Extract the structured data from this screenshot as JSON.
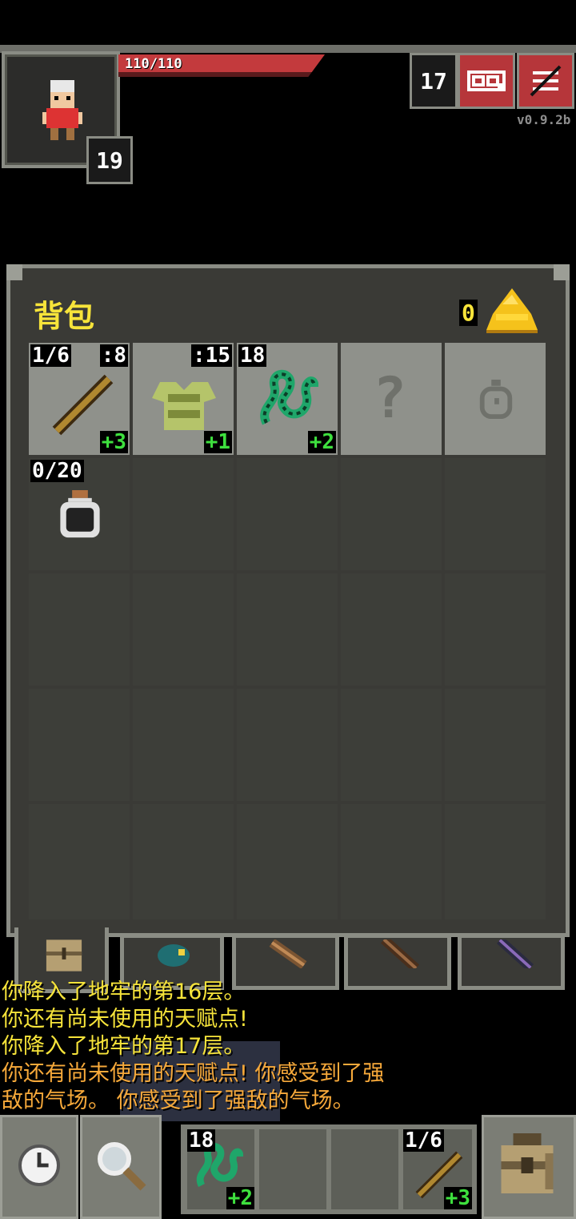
{
  "hud": {
    "hp_text": "110/110",
    "hero_level": "19",
    "depth": "17",
    "version": "v0.9.2b",
    "journal_icon": "journal-icon",
    "menu_icon": "menu-icon",
    "colors": {
      "hp": "#c33a3d",
      "accent_gold": "#f7e43a"
    }
  },
  "backpack": {
    "title": "背包",
    "gold": "0",
    "gold_icon": "gold-pile-icon",
    "equipped": [
      {
        "name": "wand",
        "icon": "wand-icon",
        "top_left": "1/6",
        "top_right": ":8",
        "level": "+3"
      },
      {
        "name": "armor",
        "icon": "armor-icon",
        "top_left": "",
        "top_right": ":15",
        "level": "+1"
      },
      {
        "name": "ring",
        "icon": "chain-ring-icon",
        "top_left": "18",
        "top_right": "",
        "level": "+2"
      },
      {
        "name": "misc-slot",
        "icon": "unknown-slot-icon",
        "top_left": "",
        "top_right": "",
        "level": ""
      },
      {
        "name": "artifact-slot",
        "icon": "bag-slot-icon",
        "top_left": "",
        "top_right": "",
        "level": ""
      }
    ],
    "items": [
      {
        "name": "dew-vial",
        "icon": "vial-icon",
        "top_left": "0/20"
      }
    ],
    "tabs": [
      {
        "name": "backpack-tab",
        "icon": "backpack-icon",
        "active": true
      },
      {
        "name": "seed-pouch-tab",
        "icon": "pouch-icon",
        "active": false
      },
      {
        "name": "scroll-holder-tab",
        "icon": "scroll-holder-icon",
        "active": false
      },
      {
        "name": "potion-bandolier-tab",
        "icon": "bandolier-icon",
        "active": false
      },
      {
        "name": "wand-holster-tab",
        "icon": "holster-icon",
        "active": false
      }
    ]
  },
  "log": {
    "lines": [
      {
        "text": "你降入了地牢的第16层。",
        "color": "#f7e43a"
      },
      {
        "text": "你还有尚未使用的天赋点!",
        "color": "#f7e43a"
      },
      {
        "text": "你降入了地牢的第17层。",
        "color": "#f7e43a"
      },
      {
        "text": "你还有尚未使用的天赋点!  你感受到了强",
        "color": "#f7a93a"
      },
      {
        "text": "敌的气场。 你感受到了强敌的气场。",
        "color": "#f7a93a"
      }
    ]
  },
  "toolbar": {
    "wait_icon": "clock-icon",
    "search_icon": "magnifier-icon",
    "quickslots": [
      {
        "icon": "chain-ring-icon",
        "top_left": "18",
        "level": "+2"
      },
      {
        "icon": "",
        "top_left": "",
        "level": ""
      },
      {
        "icon": "",
        "top_left": "",
        "level": ""
      },
      {
        "icon": "wand-icon",
        "top_left": "1/6",
        "level": "+3"
      }
    ],
    "inventory_icon": "backpack-icon"
  }
}
